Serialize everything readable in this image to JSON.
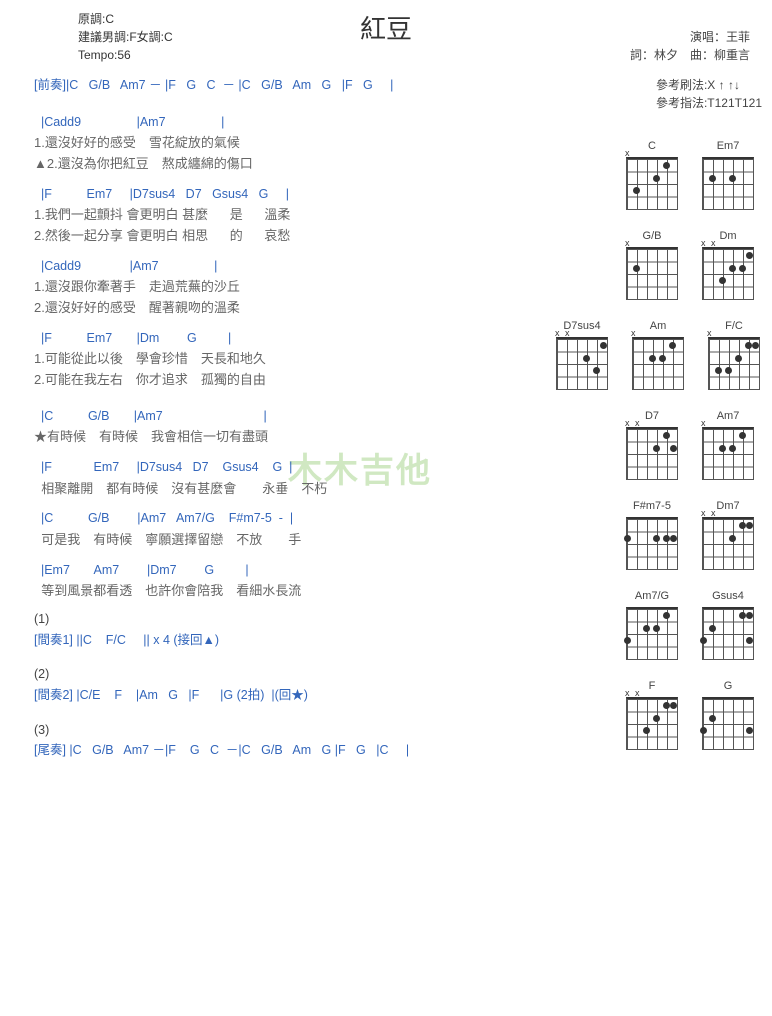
{
  "title": "紅豆",
  "meta_left": {
    "l1": "原調:C",
    "l2": "建議男調:F女調:C",
    "l3": "Tempo:56"
  },
  "meta_right": {
    "l1": "演唱：王菲",
    "l2": "詞：林夕　曲：柳重言"
  },
  "refs": {
    "l1": "參考刷法:X ↑ ↑↓",
    "l2": "參考指法:T121T121"
  },
  "intro": "[前奏]|C   G/B   Am7 － |F   G   C  － |C   G/B   Am   G   |F   G     |",
  "verse1": {
    "c1": "  |Cadd9                |Am7                |",
    "l1a": "1.還沒好好的感受　雪花綻放的氣候",
    "l1b": "▲2.還沒為你把紅豆　熬成纏綿的傷口",
    "c2": "  |F          Em7     |D7sus4   D7   Gsus4   G     |",
    "l2a": "1.我們一起顫抖 會更明白 甚麼      是      溫柔",
    "l2b": "2.然後一起分享 會更明白 相思      的      哀愁",
    "c3": "  |Cadd9              |Am7                |",
    "l3a": "1.還沒跟你牽著手　走過荒蕪的沙丘",
    "l3b": "2.還沒好好的感受　醒著親吻的溫柔",
    "c4": "  |F          Em7       |Dm        G         |",
    "l4a": "1.可能從此以後　學會珍惜　天長和地久",
    "l4b": "2.可能在我左右　你才追求　孤獨的自由"
  },
  "chorus": {
    "c1": "  |C          G/B       |Am7                             |",
    "l1": "★有時候　有時候　我會相信一切有盡頭",
    "c2": "  |F            Em7     |D7sus4   D7    Gsus4    G  |",
    "l2": "  相聚離開　都有時候　沒有甚麼會　　永垂　不朽",
    "c3": "  |C          G/B        |Am7   Am7/G    F#m7-5  -  |",
    "l3": "  可是我　有時候　寧願選擇留戀　不放　　手",
    "c4": "  |Em7       Am7        |Dm7        G         |",
    "l4": "  等到風景都看透　也許你會陪我　看細水長流"
  },
  "bridges": {
    "n1": "(1)",
    "b1": "[間奏1] ||C    F/C     || x 4 (接回▲)",
    "n2": "(2)",
    "b2": "[間奏2] |C/E    F    |Am   G   |F      |G (2拍)  |(回★)",
    "n3": "(3)",
    "b3": "[尾奏] |C   G/B   Am7 －|F    G   C  －|C   G/B   Am   G |F   G   |C     |"
  },
  "watermark": "木木吉他",
  "diagrams": {
    "row1": [
      "C",
      "Em7"
    ],
    "row2": [
      "G/B",
      "Dm"
    ],
    "row3": [
      "D7sus4",
      "Am",
      "F/C"
    ],
    "row4": [
      "D7",
      "Am7"
    ],
    "row5": [
      "F#m7-5",
      "Dm7"
    ],
    "row6": [
      "Am7/G",
      "Gsus4"
    ],
    "row7": [
      "F",
      "G"
    ]
  }
}
